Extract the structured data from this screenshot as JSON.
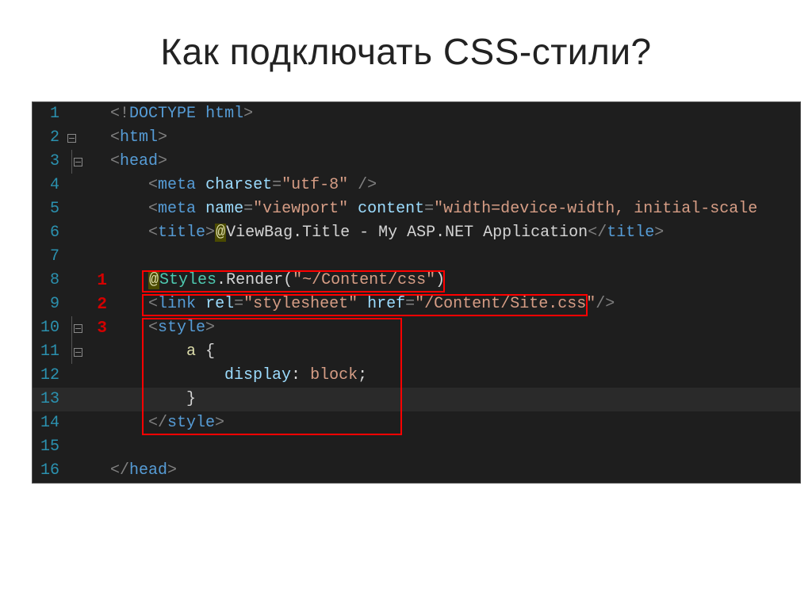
{
  "title": "Как подключать CSS-стили?",
  "annotations": {
    "l8": "1",
    "l9": "2",
    "l10": "3"
  },
  "lines": {
    "l1": {
      "num": "1"
    },
    "l2": {
      "num": "2"
    },
    "l3": {
      "num": "3"
    },
    "l4": {
      "num": "4"
    },
    "l5": {
      "num": "5"
    },
    "l6": {
      "num": "6"
    },
    "l7": {
      "num": "7"
    },
    "l8": {
      "num": "8"
    },
    "l9": {
      "num": "9"
    },
    "l10": {
      "num": "10"
    },
    "l11": {
      "num": "11"
    },
    "l12": {
      "num": "12"
    },
    "l13": {
      "num": "13"
    },
    "l14": {
      "num": "14"
    },
    "l15": {
      "num": "15"
    },
    "l16": {
      "num": "16"
    }
  },
  "tokens": {
    "lt": "<",
    "gt": ">",
    "lts": "</",
    "sgt": "/>",
    "excl": "!",
    "eq": "=",
    "sp": " ",
    "at": "@",
    "ob": "{",
    "cb": "}",
    "colon": ":",
    "semi": ";",
    "lp": "(",
    "rp": ")",
    "comma": ",",
    "doctype": "DOCTYPE",
    "html": "html",
    "head": "head",
    "meta": "meta",
    "title": "title",
    "link": "link",
    "style": "style",
    "charset": "charset",
    "name": "name",
    "content": "content",
    "rel": "rel",
    "href": "href",
    "utf8": "\"utf-8\"",
    "viewport": "\"viewport\"",
    "vcontent": "\"width=device-width, initial-scale",
    "stylesheet": "\"stylesheet\"",
    "sitecss": "\"/Content/Site.css\"",
    "contentcss": "\"~/Content/css\"",
    "viewbag": "ViewBag",
    "dot": ".",
    "Title": "Title",
    "titlestr": " - My ASP.NET Application",
    "Styles": "Styles",
    "Render": "Render",
    "a": "a",
    "display": "display",
    "block": " block",
    "ind1": "    ",
    "ind2": "        ",
    "ind3": "            ",
    "ind4": "                "
  }
}
